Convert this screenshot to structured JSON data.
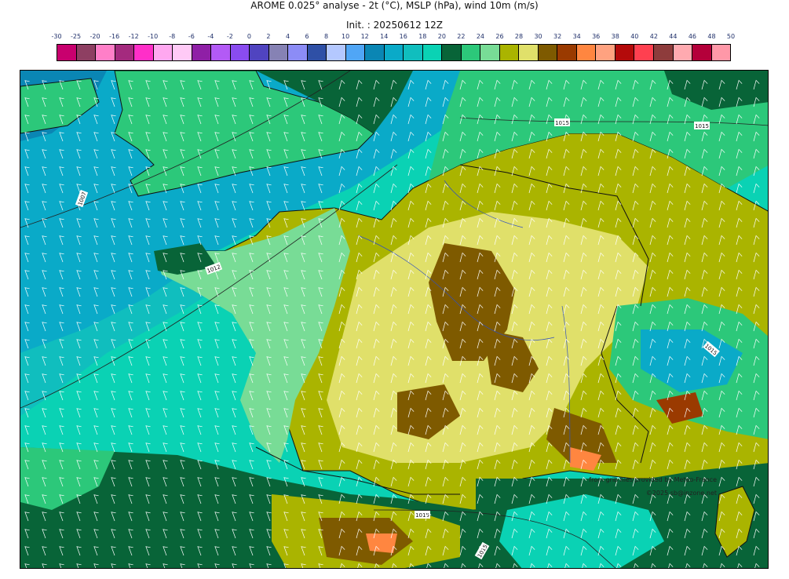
{
  "header": {
    "title": "AROME 0.025° analyse - 2t (°C), MSLP (hPa), wind 10m (m/s)",
    "subtitle": "Init. : 20250612 12Z"
  },
  "legend": {
    "labels": [
      "-30",
      "-25",
      "-20",
      "-16",
      "-12",
      "-10",
      "-8",
      "-6",
      "-4",
      "-2",
      "0",
      "2",
      "4",
      "6",
      "8",
      "10",
      "12",
      "14",
      "16",
      "18",
      "20",
      "22",
      "24",
      "26",
      "28",
      "30",
      "32",
      "34",
      "36",
      "38",
      "40",
      "42",
      "44",
      "46",
      "48",
      "50"
    ],
    "colors": [
      "#c8006e",
      "#8e3f62",
      "#ff7fc8",
      "#a42a7e",
      "#ff2fc8",
      "#ffa8f0",
      "#ffcaf6",
      "#8f1fa6",
      "#b35af6",
      "#8a4cf0",
      "#5044c0",
      "#8682b4",
      "#8c8cf6",
      "#2f50a6",
      "#b4c8ff",
      "#50a6f6",
      "#0a86b4",
      "#0aaac8",
      "#10bebe",
      "#0ad2b4",
      "#086438",
      "#2cc87a",
      "#78dc96",
      "#aab400",
      "#e0e06a",
      "#7e5a00",
      "#9a3a00",
      "#ff8640",
      "#ffa280",
      "#b40a0a",
      "#ff4050",
      "#8e3c3c",
      "#ffaab0",
      "#b4003a",
      "#ff98a8"
    ]
  },
  "map": {
    "isobar_labels": [
      "1015",
      "1015",
      "1007",
      "1012",
      "1015",
      "1015",
      "1015"
    ],
    "credits": {
      "line1": "from grib files provided by Meteo-France",
      "line2": "©2025 sb@inzone.net"
    }
  }
}
